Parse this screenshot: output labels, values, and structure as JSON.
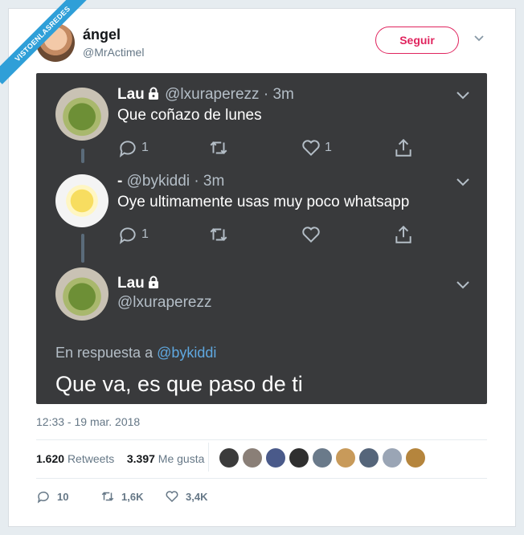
{
  "watermark": "VISTOENLASREDES",
  "header": {
    "name": "ángel",
    "handle": "@MrActimel",
    "follow_label": "Seguir"
  },
  "thread": [
    {
      "name": "Lau",
      "handle": "@lxuraperezz",
      "time": "· 3m",
      "text": "Que coñazo de lunes",
      "replies": "1",
      "retweets": "",
      "likes": "1"
    },
    {
      "name": "-",
      "handle": "@bykiddi",
      "time": "· 3m",
      "text": "Oye ultimamente usas muy poco whatsapp",
      "replies": "1",
      "retweets": "",
      "likes": ""
    }
  ],
  "main_tweet": {
    "name": "Lau",
    "handle": "@lxuraperezz",
    "reply_prefix": "En respuesta a",
    "reply_to": "@bykiddi",
    "text": "Que va, es que paso de ti"
  },
  "timestamp": "12:33 - 19 mar. 2018",
  "stats": {
    "retweets_count": "1.620",
    "retweets_label": "Retweets",
    "likes_count": "3.397",
    "likes_label": "Me gusta"
  },
  "likers": [
    "#3b3b3b",
    "#8a7f77",
    "#4a5a8a",
    "#2f2f2f",
    "#6a7a8a",
    "#c89a5a",
    "#55657a",
    "#9aa5b5",
    "#b5853d"
  ],
  "actions": {
    "replies": "10",
    "retweets": "1,6K",
    "likes": "3,4K"
  },
  "colors": {
    "accent": "#e0245e",
    "link": "#5fa8e0",
    "panel": "#393a3c"
  }
}
